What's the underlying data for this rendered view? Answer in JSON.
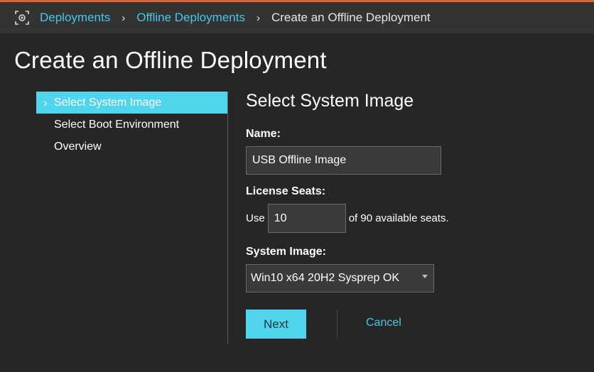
{
  "breadcrumb": {
    "icon": "deployment-icon",
    "items": [
      {
        "label": "Deployments",
        "link": true
      },
      {
        "label": "Offline Deployments",
        "link": true
      },
      {
        "label": "Create an Offline Deployment",
        "link": false
      }
    ],
    "separator": "›"
  },
  "page": {
    "title": "Create an Offline Deployment"
  },
  "nav": {
    "items": [
      {
        "label": "Select System Image",
        "active": true
      },
      {
        "label": "Select Boot Environment",
        "active": false
      },
      {
        "label": "Overview",
        "active": false
      }
    ]
  },
  "form": {
    "section_title": "Select System Image",
    "name_label": "Name:",
    "name_value": "USB Offline Image",
    "seats_label": "License Seats:",
    "seats_prefix": "Use",
    "seats_value": "10",
    "seats_suffix": "of 90 available seats.",
    "image_label": "System Image:",
    "image_value": "Win10 x64 20H2 Sysprep OK"
  },
  "actions": {
    "next_label": "Next",
    "cancel_label": "Cancel"
  },
  "colors": {
    "accent": "#4fd6ee",
    "link": "#46c8e6",
    "background": "#262626",
    "header": "#333333"
  }
}
